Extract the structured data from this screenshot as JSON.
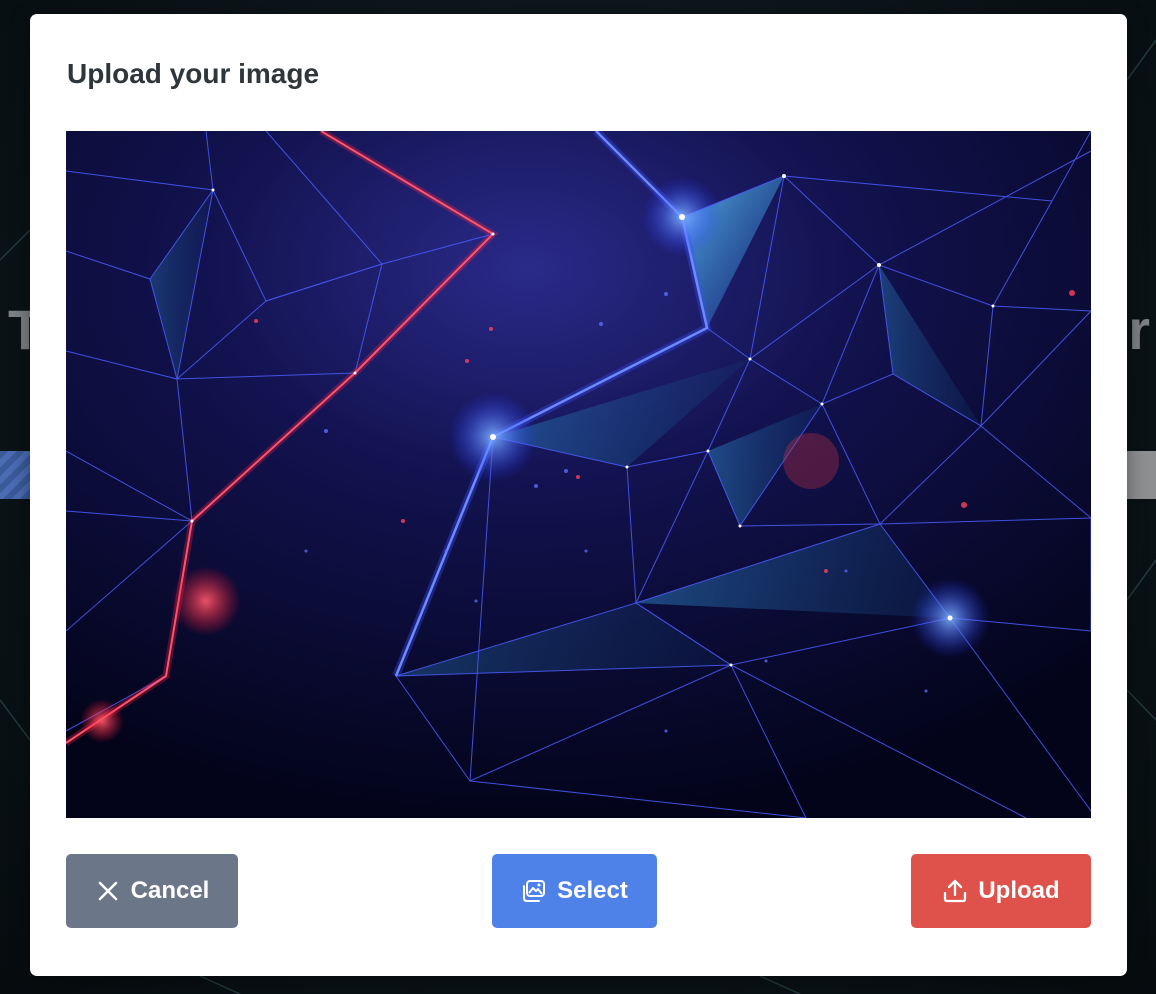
{
  "background": {
    "heading_left_fragment": "T",
    "heading_right_fragment": "r"
  },
  "modal": {
    "title": "Upload your image",
    "preview_alt": "Abstract polygon network image"
  },
  "buttons": {
    "cancel": {
      "label": "Cancel",
      "icon": "close-icon",
      "color": "#6c7689"
    },
    "select": {
      "label": "Select",
      "icon": "images-icon",
      "color": "#4f82e8"
    },
    "upload": {
      "label": "Upload",
      "icon": "upload-icon",
      "color": "#df524b"
    }
  }
}
